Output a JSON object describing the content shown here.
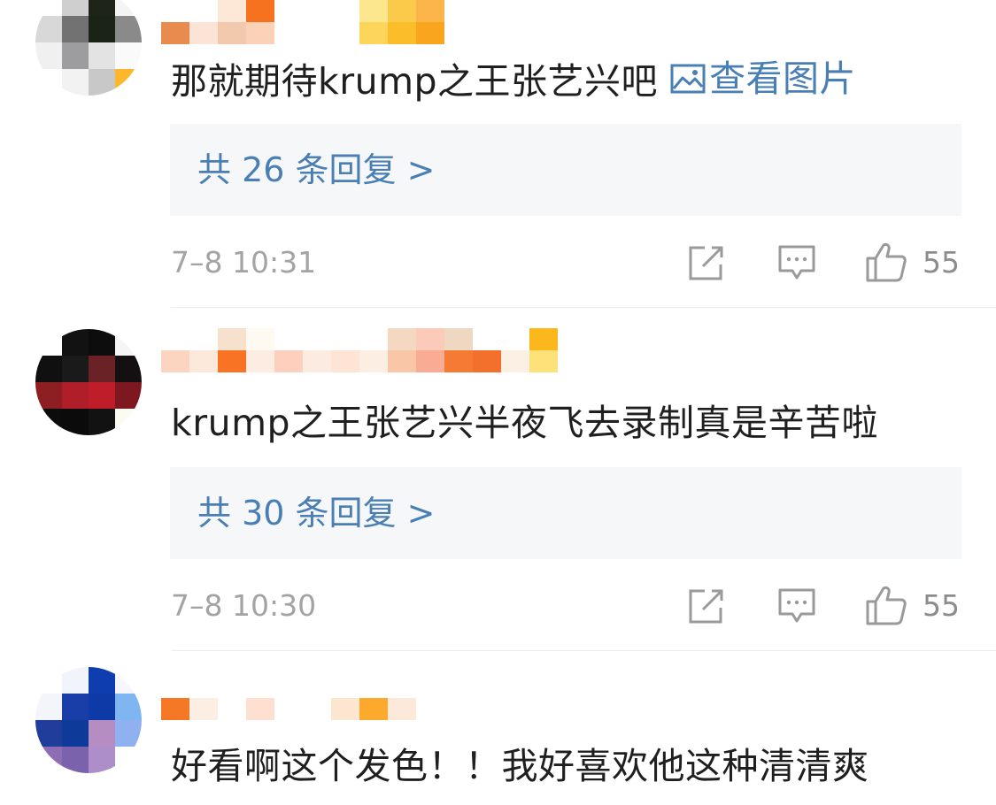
{
  "comments": [
    {
      "text": "那就期待krump之王张艺兴吧",
      "image_link": "查看图片",
      "reply_label": "共 26 条回复 >",
      "time": "7–8 10:31",
      "likes": "55",
      "icons": {
        "share": "share-icon",
        "comment": "comment-icon",
        "like": "thumbs-up-icon"
      }
    },
    {
      "text": "krump之王张艺兴半夜飞去录制真是辛苦啦",
      "reply_label": "共 30 条回复 >",
      "time": "7–8 10:30",
      "likes": "55",
      "icons": {
        "share": "share-icon",
        "comment": "comment-icon",
        "like": "thumbs-up-icon"
      }
    },
    {
      "text": "好看啊这个发色！！我好喜欢他这种清清爽"
    }
  ],
  "colors": {
    "link": "#4a7fb5",
    "body_text": "#1f1f1f",
    "meta_text": "#a3a3a3",
    "reply_bg": "#f6f7f9"
  }
}
